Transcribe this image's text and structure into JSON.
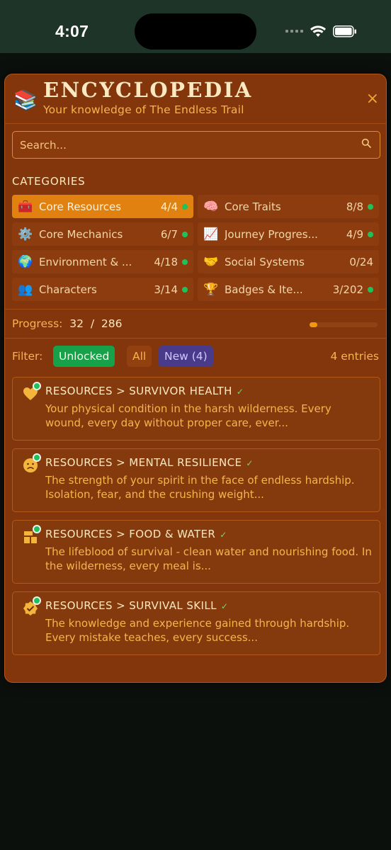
{
  "status_bar": {
    "time": "4:07"
  },
  "encyclopedia": {
    "title": "ENCYCLOPEDIA",
    "subtitle": "Your knowledge of The Endless Trail",
    "close_label": "×",
    "search": {
      "placeholder": "Search...",
      "value": ""
    },
    "categories_heading": "CATEGORIES",
    "categories": [
      {
        "icon": "🧰",
        "icon_name": "toolbox-icon",
        "label": "Core Resources",
        "count": "4/4",
        "active": true
      },
      {
        "icon": "🧠",
        "icon_name": "brain-icon",
        "label": "Core Traits",
        "count": "8/8",
        "active": false
      },
      {
        "icon": "⚙️",
        "icon_name": "gear-icon",
        "label": "Core Mechanics",
        "count": "6/7",
        "active": false
      },
      {
        "icon": "📈",
        "icon_name": "chart-up-icon",
        "label": "Journey Progres...",
        "count": "4/9",
        "active": false
      },
      {
        "icon": "🌍",
        "icon_name": "globe-icon",
        "label": "Environment & ...",
        "count": "4/18",
        "active": false
      },
      {
        "icon": "🤝",
        "icon_name": "handshake-icon",
        "label": "Social Systems",
        "count": "0/24",
        "active": false
      },
      {
        "icon": "👥",
        "icon_name": "people-icon",
        "label": "Characters",
        "count": "3/14",
        "active": false
      },
      {
        "icon": "🏆",
        "icon_name": "trophy-icon",
        "label": "Badges & Ite...",
        "count": "3/202",
        "active": false
      }
    ],
    "progress": {
      "label": "Progress:",
      "current": "32",
      "separator": "/",
      "total": "286",
      "fraction": 0.112
    },
    "filter": {
      "label": "Filter:",
      "options": {
        "unlocked": "Unlocked",
        "all": "All",
        "new": "New (4)"
      },
      "entries_count": "4 entries"
    },
    "entries": [
      {
        "icon_name": "heart-icon",
        "title": "RESOURCES > SURVIVOR HEALTH",
        "check": "✓",
        "description": "Your physical condition in the harsh wilderness. Every wound, every day without proper care, ever..."
      },
      {
        "icon_name": "worried-face-icon",
        "title": "RESOURCES > MENTAL RESILIENCE",
        "check": "✓",
        "description": "The strength of your spirit in the face of endless hardship. Isolation, fear, and the crushing weight..."
      },
      {
        "icon_name": "food-water-icon",
        "title": "RESOURCES > FOOD & WATER",
        "check": "✓",
        "description": "The lifeblood of survival - clean water and nourishing food. In the wilderness, every meal is..."
      },
      {
        "icon_name": "skill-badge-icon",
        "title": "RESOURCES > SURVIVAL SKILL",
        "check": "✓",
        "description": "The knowledge and experience gained through hardship. Every mistake teaches, every success..."
      }
    ]
  },
  "colors": {
    "panel_bg": "#83360b",
    "accent_orange": "#e1810f",
    "unlocked_green": "#17a24a",
    "new_purple": "#4a3b8a",
    "status_bar_bg": "#1f3429"
  }
}
